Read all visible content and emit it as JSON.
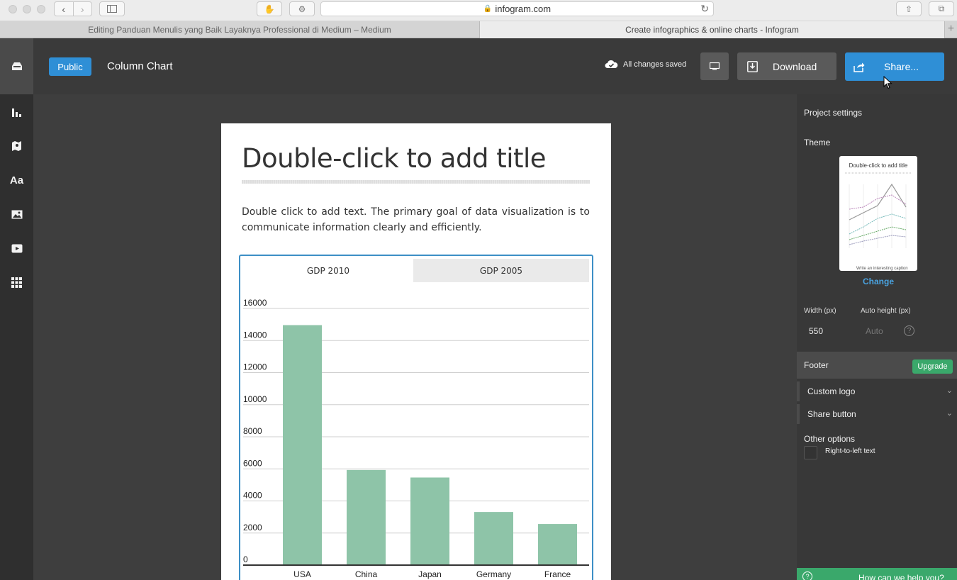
{
  "browser": {
    "address": "infogram.com",
    "tabs": [
      "Editing Panduan Menulis yang Baik Layaknya Professional di Medium – Medium",
      "Create infographics & online charts - Infogram"
    ],
    "new_tab": "+"
  },
  "sidebar": {
    "items": [
      {
        "icon": "inbox-icon"
      },
      {
        "icon": "bar-chart-icon"
      },
      {
        "icon": "map-pin-icon"
      },
      {
        "label": "Aa",
        "icon": "text-icon"
      },
      {
        "icon": "image-icon"
      },
      {
        "icon": "video-icon"
      },
      {
        "icon": "grid-icon"
      }
    ]
  },
  "topbar": {
    "visibility_badge": "Public",
    "project_title": "Column Chart",
    "save_status": "All changes saved",
    "download_label": "Download",
    "share_label": "Share..."
  },
  "card": {
    "title": "Double-click to add title",
    "body": "Double click to add text. The primary goal of data visualization is to communicate information clearly and efficiently.",
    "chart_tabs": [
      "GDP 2010",
      "GDP 2005"
    ],
    "active_tab": "GDP 2010"
  },
  "chart_data": {
    "type": "bar",
    "categories": [
      "USA",
      "China",
      "Japan",
      "Germany",
      "France"
    ],
    "values": [
      14960,
      5930,
      5460,
      3310,
      2560
    ],
    "yticks": [
      0,
      2000,
      4000,
      6000,
      8000,
      10000,
      12000,
      14000,
      16000
    ],
    "ylim": [
      0,
      16000
    ],
    "grid": true,
    "bar_color": "#8ec4a8"
  },
  "right_panel": {
    "project_settings": "Project settings",
    "theme_label": "Theme",
    "theme_thumb_title": "Double-click to add title",
    "theme_thumb_caption": "Write an interesting caption",
    "change_label": "Change",
    "width_label": "Width (px)",
    "width_value": "550",
    "height_label": "Auto height (px)",
    "height_value": "Auto",
    "footer_label": "Footer",
    "upgrade_label": "Upgrade",
    "custom_logo": "Custom logo",
    "share_button": "Share button",
    "other_options": "Other options",
    "rtl_label": "Right-to-left text"
  },
  "help": {
    "label": "How can we help you?"
  },
  "colors": {
    "accent": "#2f8fd6",
    "upgrade": "#3aa86b",
    "bar": "#8ec4a8"
  }
}
